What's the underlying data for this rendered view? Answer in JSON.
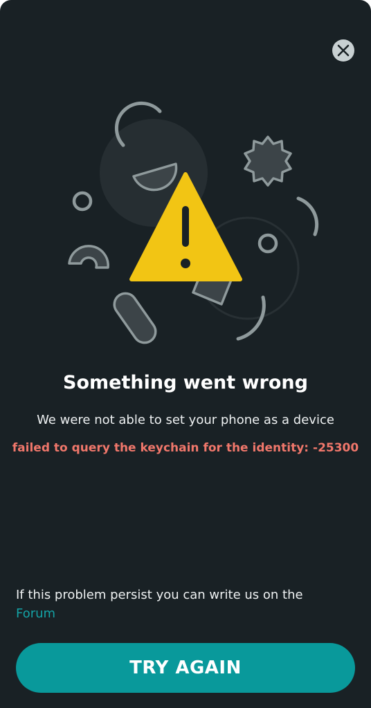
{
  "dialog": {
    "close_icon": "close-icon",
    "illustration_icon": "warning-icon",
    "title": "Something went wrong",
    "message": "We were not able to set your phone as a device",
    "error": "failed to query the keychain for the identity: -25300",
    "help_text": "If this problem persist you can write us on the",
    "help_link": "Forum",
    "button_label": "TRY AGAIN"
  },
  "colors": {
    "background": "#192125",
    "warning": "#f2c514",
    "error": "#f0776b",
    "accent": "#09999b",
    "link": "#14a3a6"
  }
}
